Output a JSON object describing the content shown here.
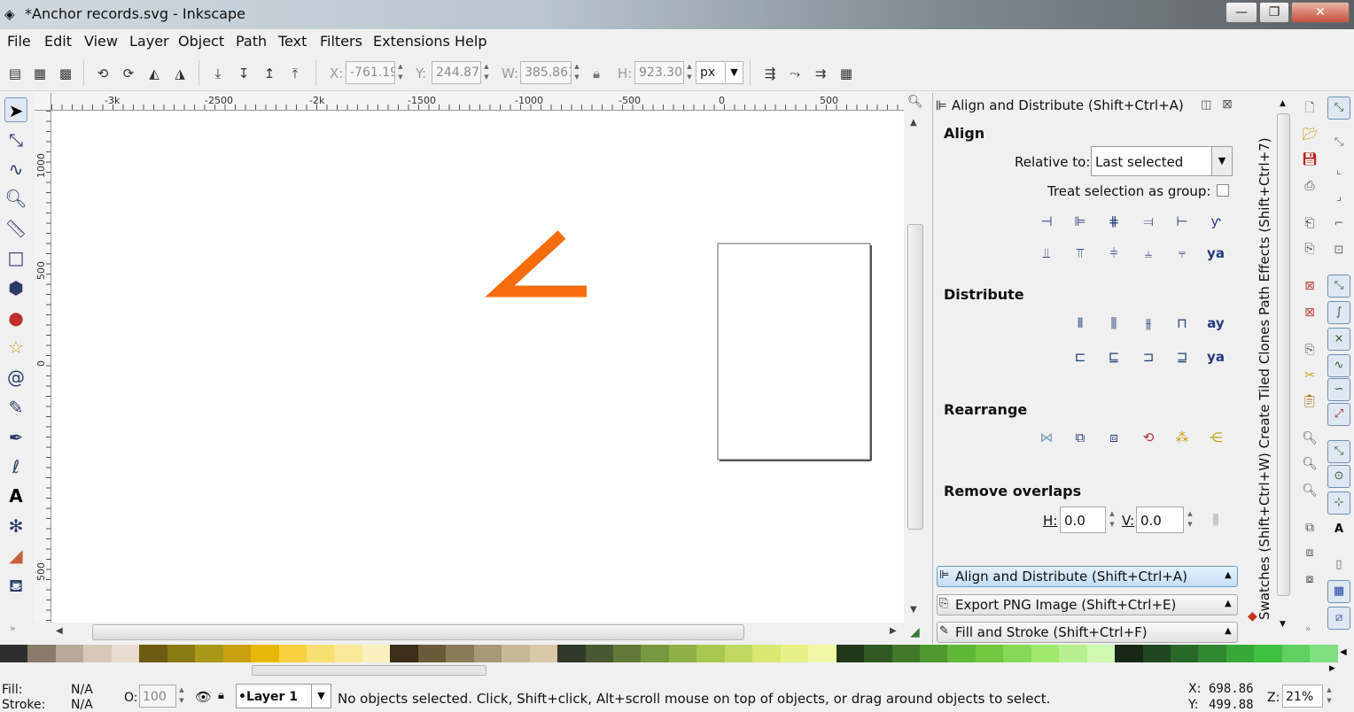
{
  "window": {
    "title": "*Anchor records.svg - Inkscape",
    "minimize": "—",
    "maximize": "❐",
    "close": "✕"
  },
  "menu": [
    "File",
    "Edit",
    "View",
    "Layer",
    "Object",
    "Path",
    "Text",
    "Filters",
    "Extensions",
    "Help"
  ],
  "selectbar": {
    "x_label": "X:",
    "x_value": "-761.19",
    "y_label": "Y:",
    "y_value": "244.877",
    "w_label": "W:",
    "w_value": "385.861",
    "h_label": "H:",
    "h_value": "923.304",
    "unit": "px"
  },
  "ruler": {
    "ticks": [
      "-3k",
      "-2500",
      "-2k",
      "-1500",
      "-1000",
      "-500",
      "0",
      "500"
    ],
    "vticks": [
      "1000",
      "500",
      "0",
      "500"
    ]
  },
  "dock": {
    "title": "Align and Distribute (Shift+Ctrl+A)",
    "align_heading": "Align",
    "relative_label": "Relative to:",
    "relative_value": "Last selected",
    "group_label": "Treat selection as group:",
    "distribute_heading": "Distribute",
    "rearrange_heading": "Rearrange",
    "overlaps_heading": "Remove overlaps",
    "h_label": "H:",
    "h_value": "0.0",
    "v_label": "V:",
    "v_value": "0.0",
    "panels": [
      "Align and Distribute (Shift+Ctrl+A)",
      "Export PNG Image (Shift+Ctrl+E)",
      "Fill and Stroke (Shift+Ctrl+F)"
    ]
  },
  "vtabs": {
    "text": "Swatches (Shift+Ctrl+W)    Create Tiled Clones    Path Effects  (Shift+Ctrl+7)"
  },
  "status": {
    "fill_label": "Fill:",
    "fill_value": "N/A",
    "stroke_label": "Stroke:",
    "stroke_value": "N/A",
    "opacity_label": "O:",
    "opacity_value": "100",
    "layer": "•Layer 1",
    "message": "No objects selected. Click, Shift+click, Alt+scroll mouse on top of objects, or drag around objects to select.",
    "x_label": "X:",
    "x_value": "698.86",
    "y_label": "Y:",
    "y_value": "499.88",
    "zoom_label": "Z:",
    "zoom_value": "21%"
  },
  "colors": {
    "accent": "#f76c0c",
    "panel_active": "#cfe6fb"
  },
  "palette": [
    "#2e2e2e",
    "#8a7a6a",
    "#b8a898",
    "#d8c8b8",
    "#e8dcd0",
    "#6a5a12",
    "#8a7a16",
    "#a89818",
    "#c8a010",
    "#e8b808",
    "#f8d040",
    "#f8e070",
    "#f8e898",
    "#faf0c0",
    "#3c2e18",
    "#6a5a38",
    "#8a7a58",
    "#a89878",
    "#c8b898",
    "#d8c8a8",
    "#303828",
    "#485830",
    "#607838",
    "#789840",
    "#90b048",
    "#a8c850",
    "#c0d860",
    "#d8e870",
    "#e8f088",
    "#f0f8a8",
    "#203818",
    "#305820",
    "#407828",
    "#509830",
    "#60b838",
    "#70c840",
    "#88d858",
    "#a0e870",
    "#b8f090",
    "#d0f8b0",
    "#182818",
    "#204820",
    "#286828",
    "#308830",
    "#38a838",
    "#40c040",
    "#60d060",
    "#80e080"
  ],
  "icons": {
    "select": "selector-arrow-icon",
    "node": "node-tool-icon"
  }
}
